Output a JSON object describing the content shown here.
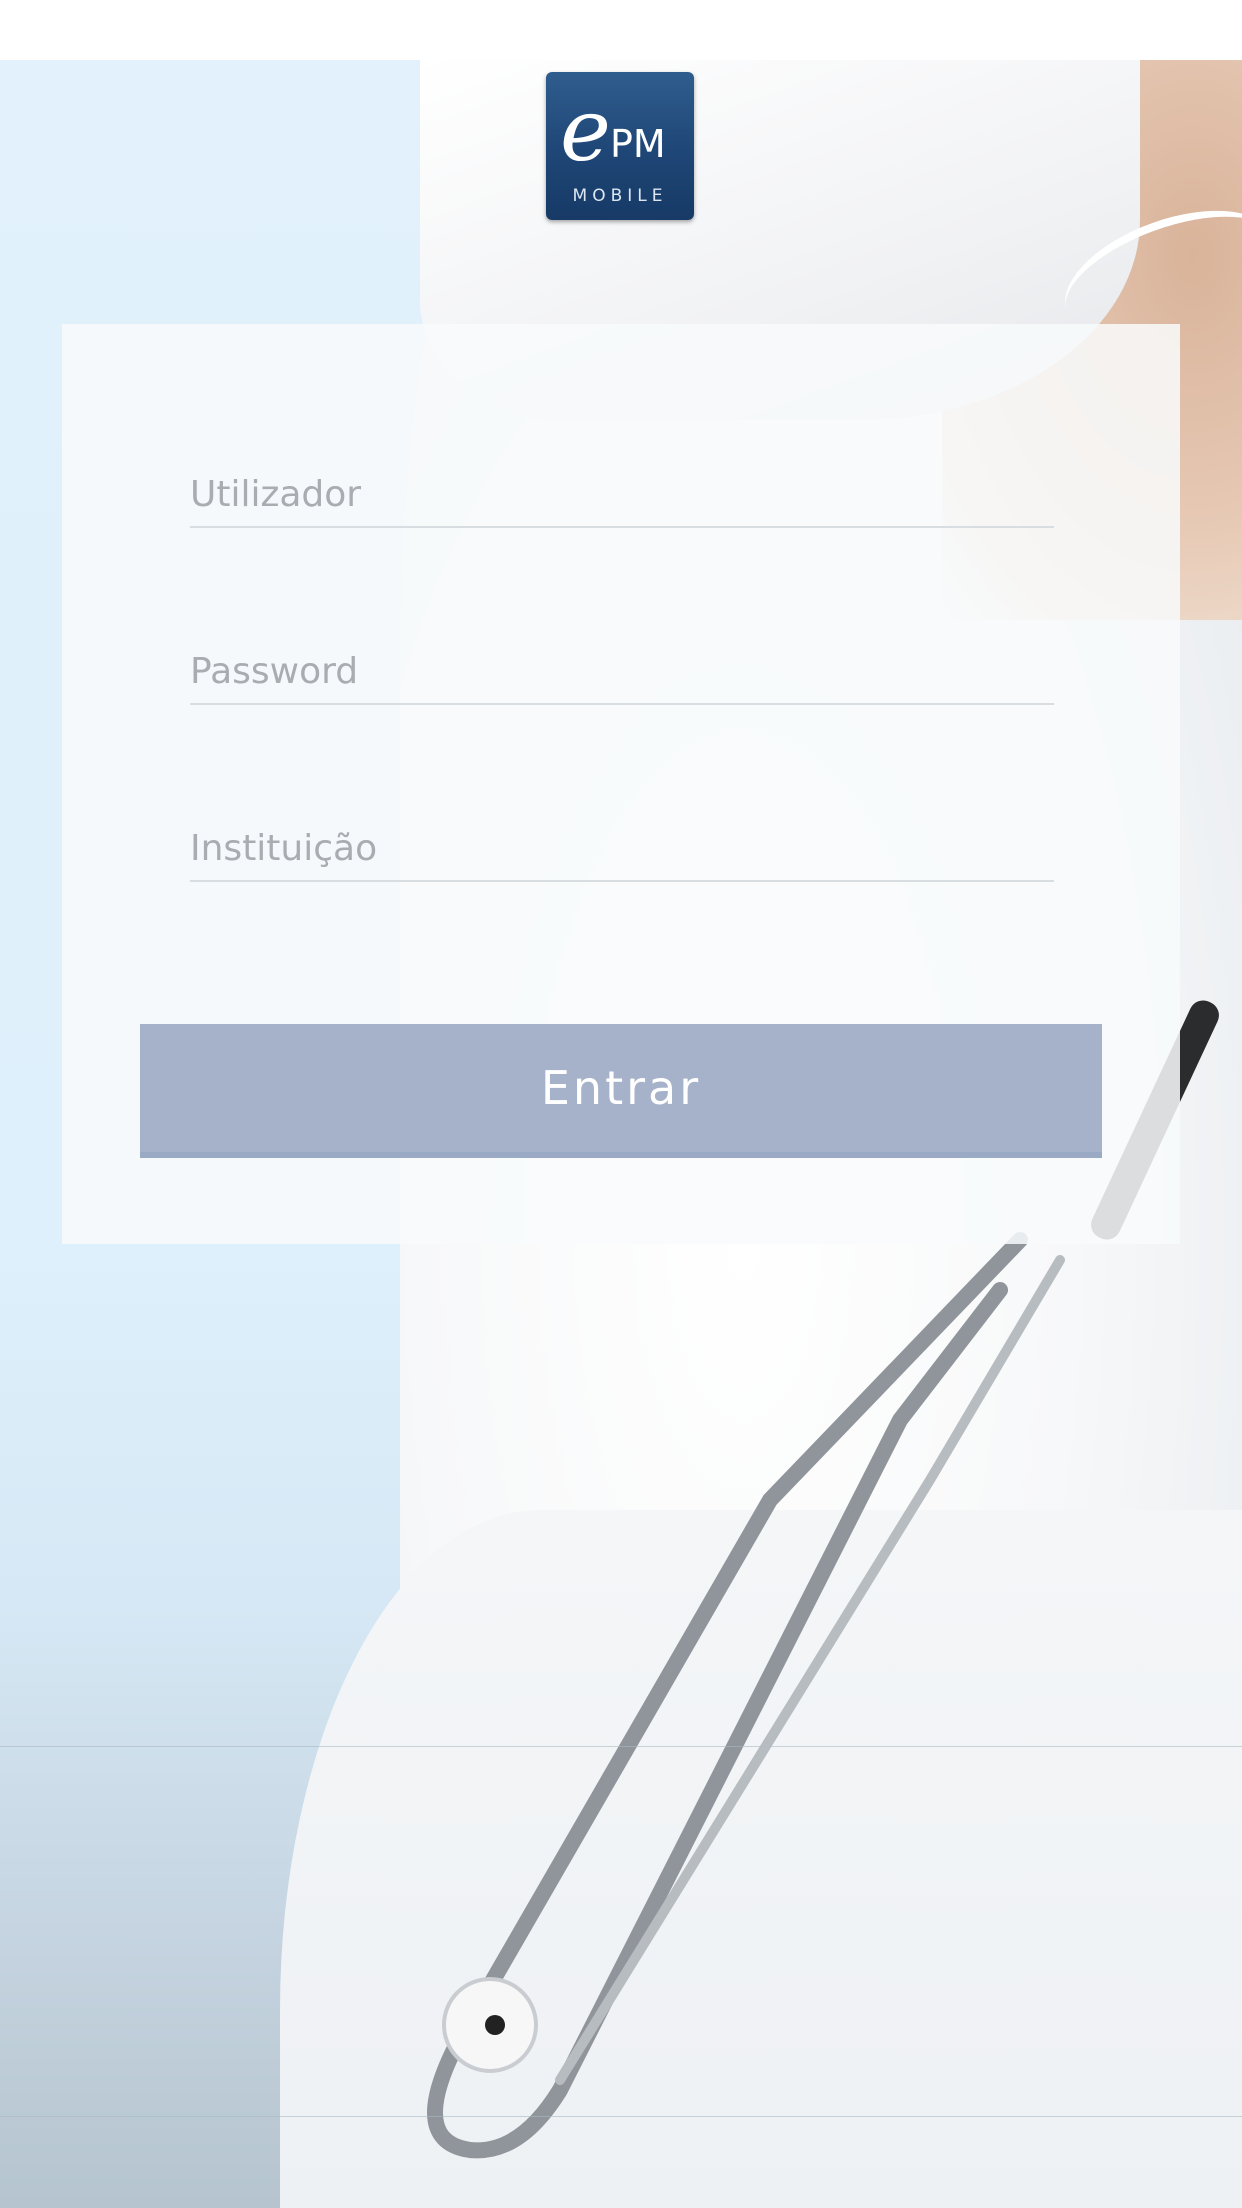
{
  "logo": {
    "letter": "e",
    "brand": "PM",
    "subtitle": "MOBILE"
  },
  "login_form": {
    "username_placeholder": "Utilizador",
    "password_placeholder": "Password",
    "institution_placeholder": "Instituição",
    "submit_label": "Entrar"
  },
  "colors": {
    "logo_background": "#1e4676",
    "button_background": "#a5b2c9",
    "background_tint": "#e2f1fb"
  }
}
